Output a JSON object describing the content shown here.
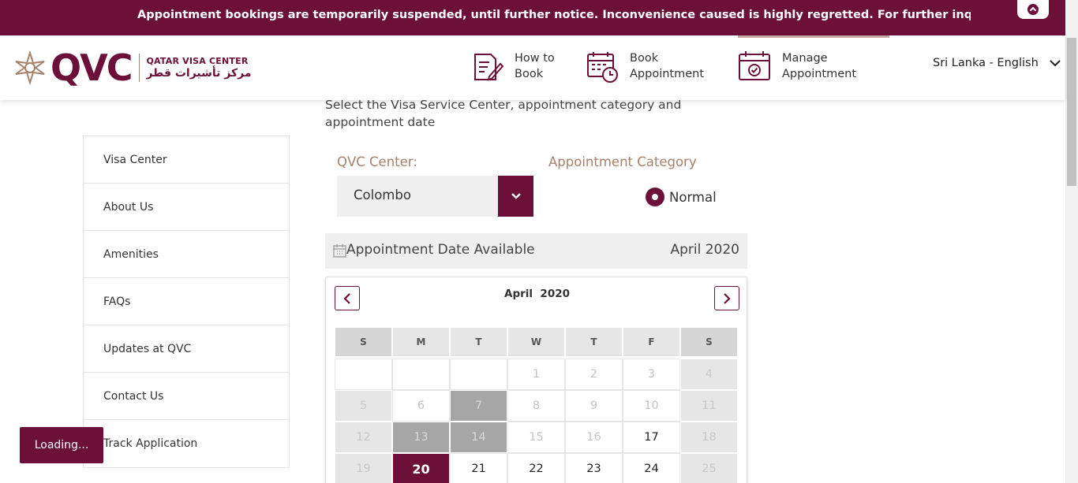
{
  "banner": {
    "message": "Appointment bookings are temporarily suspended, until further notice. Inconvenience caused is highly regretted. For further inquiries, please contact"
  },
  "header": {
    "logo": {
      "brand": "QVC",
      "name_en": "QATAR VISA CENTER",
      "name_ar": "مركز تأشيرات قطر"
    },
    "nav": [
      {
        "line1": "How to",
        "line2": "Book",
        "icon": "document-pen-icon"
      },
      {
        "line1": "Book",
        "line2": "Appointment",
        "icon": "calendar-clock-icon"
      },
      {
        "line1": "Manage",
        "line2": "Appointment",
        "icon": "calendar-check-icon"
      }
    ],
    "language": "Sri Lanka - English"
  },
  "sidebar": {
    "items": [
      "Visa Center",
      "About Us",
      "Amenities",
      "FAQs",
      "Updates at QVC",
      "Contact Us",
      "Track Application"
    ]
  },
  "loading_label": "Loading...",
  "main": {
    "intro": "Select the Visa Service Center, appointment category and appointment date",
    "center_label": "QVC Center:",
    "center_value": "Colombo",
    "category_label": "Appointment Category",
    "category_option": "Normal",
    "date_bar_title": "Appointment Date Available",
    "date_bar_month": "April 2020"
  },
  "calendar": {
    "title": "April  2020",
    "weekdays": [
      "S",
      "M",
      "T",
      "W",
      "T",
      "F",
      "S"
    ],
    "weeks": [
      [
        {
          "d": "",
          "s": "empty"
        },
        {
          "d": "",
          "s": "empty"
        },
        {
          "d": "",
          "s": "empty"
        },
        {
          "d": "1",
          "s": "disabled"
        },
        {
          "d": "2",
          "s": "disabled"
        },
        {
          "d": "3",
          "s": "disabled"
        },
        {
          "d": "4",
          "s": "weekend"
        }
      ],
      [
        {
          "d": "5",
          "s": "weekend"
        },
        {
          "d": "6",
          "s": "disabled"
        },
        {
          "d": "7",
          "s": "blocked"
        },
        {
          "d": "8",
          "s": "disabled"
        },
        {
          "d": "9",
          "s": "disabled"
        },
        {
          "d": "10",
          "s": "disabled"
        },
        {
          "d": "11",
          "s": "weekend"
        }
      ],
      [
        {
          "d": "12",
          "s": "weekend"
        },
        {
          "d": "13",
          "s": "blocked"
        },
        {
          "d": "14",
          "s": "blocked"
        },
        {
          "d": "15",
          "s": "disabled"
        },
        {
          "d": "16",
          "s": "disabled"
        },
        {
          "d": "17",
          "s": "avail"
        },
        {
          "d": "18",
          "s": "weekend"
        }
      ],
      [
        {
          "d": "19",
          "s": "weekend"
        },
        {
          "d": "20",
          "s": "selected"
        },
        {
          "d": "21",
          "s": "avail"
        },
        {
          "d": "22",
          "s": "avail"
        },
        {
          "d": "23",
          "s": "avail"
        },
        {
          "d": "24",
          "s": "avail"
        },
        {
          "d": "25",
          "s": "weekend"
        }
      ]
    ]
  },
  "colors": {
    "brand": "#6d1039",
    "label": "#a6826c"
  }
}
